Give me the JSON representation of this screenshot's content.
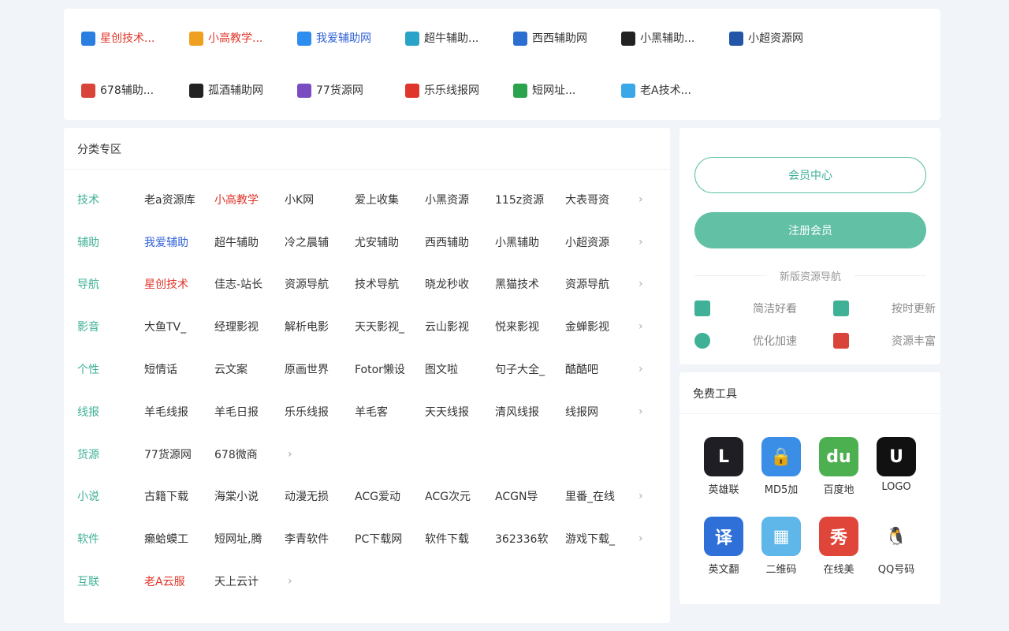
{
  "top_links": [
    {
      "label": "星创技术...",
      "color": "#e0352b",
      "icon": "star-logo-icon",
      "icon_bg": "#2a7de1"
    },
    {
      "label": "小高教学...",
      "color": "#e0352b",
      "icon": "gold-badge-icon",
      "icon_bg": "#f0a020"
    },
    {
      "label": "我爱辅助网",
      "color": "#2e5fd6",
      "icon": "edit-square-icon",
      "icon_bg": "#2e8ef0"
    },
    {
      "label": "超牛辅助...",
      "color": "#333333",
      "icon": "dj-logo-icon",
      "icon_bg": "#2aa3c8"
    },
    {
      "label": "西西辅助网",
      "color": "#333333",
      "icon": "x-logo-icon",
      "icon_bg": "#2c6fd0"
    },
    {
      "label": "小黑辅助...",
      "color": "#333333",
      "icon": "person-silhouette-icon",
      "icon_bg": "#222222"
    },
    {
      "label": "小超资源网",
      "color": "#333333",
      "icon": "flame-logo-icon",
      "icon_bg": "#2456a8"
    },
    {
      "label": "678辅助...",
      "color": "#333333",
      "icon": "678-logo-icon",
      "icon_bg": "#d8443a"
    },
    {
      "label": "孤酒辅助网",
      "color": "#333333",
      "icon": "qq-penguin-icon",
      "icon_bg": "#222222"
    },
    {
      "label": "77货源网",
      "color": "#333333",
      "icon": "seven-logo-icon",
      "icon_bg": "#7a4cc2"
    },
    {
      "label": "乐乐线报网",
      "color": "#333333",
      "icon": "s-logo-icon",
      "icon_bg": "#e0352b"
    },
    {
      "label": "短网址...",
      "color": "#333333",
      "icon": "g-logo-icon",
      "icon_bg": "#2ba24c"
    },
    {
      "label": "老A技术...",
      "color": "#333333",
      "icon": "water-drop-icon",
      "icon_bg": "#39a7e8"
    }
  ],
  "category": {
    "title": "分类专区",
    "rows": [
      {
        "name": "技术",
        "items": [
          {
            "label": "老a资源库",
            "color": "#333333"
          },
          {
            "label": "小高教学",
            "color": "#e0352b"
          },
          {
            "label": "小K网",
            "color": "#333333"
          },
          {
            "label": "爱上收集",
            "color": "#333333"
          },
          {
            "label": "小黑资源",
            "color": "#333333"
          },
          {
            "label": "115z资源",
            "color": "#333333"
          },
          {
            "label": "大表哥资",
            "color": "#333333"
          }
        ]
      },
      {
        "name": "辅助",
        "items": [
          {
            "label": "我爱辅助",
            "color": "#2e5fd6"
          },
          {
            "label": "超牛辅助",
            "color": "#333333"
          },
          {
            "label": "冷之晨辅",
            "color": "#333333"
          },
          {
            "label": "尤安辅助",
            "color": "#333333"
          },
          {
            "label": "西西辅助",
            "color": "#333333"
          },
          {
            "label": "小黑辅助",
            "color": "#333333"
          },
          {
            "label": "小超资源",
            "color": "#333333"
          }
        ]
      },
      {
        "name": "导航",
        "items": [
          {
            "label": "星创技术",
            "color": "#e0352b"
          },
          {
            "label": "佳志-站长",
            "color": "#333333"
          },
          {
            "label": "资源导航",
            "color": "#333333"
          },
          {
            "label": "技术导航",
            "color": "#333333"
          },
          {
            "label": "晓龙秒收",
            "color": "#333333"
          },
          {
            "label": "黑猫技术",
            "color": "#333333"
          },
          {
            "label": "资源导航",
            "color": "#333333"
          }
        ]
      },
      {
        "name": "影音",
        "items": [
          {
            "label": "大鱼TV_",
            "color": "#333333"
          },
          {
            "label": "经理影视",
            "color": "#333333"
          },
          {
            "label": "解析电影",
            "color": "#333333"
          },
          {
            "label": "天天影视_",
            "color": "#333333"
          },
          {
            "label": "云山影视",
            "color": "#333333"
          },
          {
            "label": "悦来影视",
            "color": "#333333"
          },
          {
            "label": "金蝉影视",
            "color": "#333333"
          }
        ]
      },
      {
        "name": "个性",
        "items": [
          {
            "label": "短情话",
            "color": "#333333"
          },
          {
            "label": "云文案",
            "color": "#333333"
          },
          {
            "label": "原画世界",
            "color": "#333333"
          },
          {
            "label": "Fotor懒设",
            "color": "#333333"
          },
          {
            "label": "图文啦",
            "color": "#333333"
          },
          {
            "label": "句子大全_",
            "color": "#333333"
          },
          {
            "label": "酷酷吧",
            "color": "#333333"
          }
        ]
      },
      {
        "name": "线报",
        "items": [
          {
            "label": "羊毛线报",
            "color": "#333333"
          },
          {
            "label": "羊毛日报",
            "color": "#333333"
          },
          {
            "label": "乐乐线报",
            "color": "#333333"
          },
          {
            "label": "羊毛客",
            "color": "#333333"
          },
          {
            "label": "天天线报",
            "color": "#333333"
          },
          {
            "label": "清风线报",
            "color": "#333333"
          },
          {
            "label": "线报网",
            "color": "#333333"
          }
        ]
      },
      {
        "name": "货源",
        "items": [
          {
            "label": "77货源网",
            "color": "#333333"
          },
          {
            "label": "678微商",
            "color": "#333333"
          }
        ]
      },
      {
        "name": "小说",
        "items": [
          {
            "label": "古籍下载",
            "color": "#333333"
          },
          {
            "label": "海棠小说",
            "color": "#333333"
          },
          {
            "label": "动漫无损",
            "color": "#333333"
          },
          {
            "label": "ACG爱动",
            "color": "#333333"
          },
          {
            "label": "ACG次元",
            "color": "#333333"
          },
          {
            "label": "ACGN导",
            "color": "#333333"
          },
          {
            "label": "里番_在线",
            "color": "#333333"
          }
        ]
      },
      {
        "name": "软件",
        "items": [
          {
            "label": "癞蛤蟆工",
            "color": "#333333"
          },
          {
            "label": "短网址,腾",
            "color": "#333333"
          },
          {
            "label": "李青软件",
            "color": "#333333"
          },
          {
            "label": "PC下载网",
            "color": "#333333"
          },
          {
            "label": "软件下载",
            "color": "#333333"
          },
          {
            "label": "362336软",
            "color": "#333333"
          },
          {
            "label": "游戏下载_",
            "color": "#333333"
          }
        ]
      },
      {
        "name": "互联",
        "items": [
          {
            "label": "老A云服",
            "color": "#e0352b"
          },
          {
            "label": "天上云计",
            "color": "#333333"
          }
        ]
      }
    ],
    "arrow": "›"
  },
  "member": {
    "center_label": "会员中心",
    "register_label": "注册会员",
    "divider_label": "新版资源导航",
    "features": [
      {
        "label": "简洁好看",
        "icon": "envelope-icon",
        "color": "#3eb197"
      },
      {
        "label": "按时更新",
        "icon": "document-icon",
        "color": "#3eb197"
      },
      {
        "label": "优化加速",
        "icon": "vip-refresh-icon",
        "color": "#3eb197"
      },
      {
        "label": "资源丰富",
        "icon": "laptop-icon",
        "color": "#d8443a"
      }
    ]
  },
  "tools": {
    "title": "免费工具",
    "items": [
      {
        "label": "英雄联",
        "icon": "lol-icon",
        "glyph": "L",
        "bg": "#1e1e24"
      },
      {
        "label": "MD5加",
        "icon": "lock-icon",
        "glyph": "🔒",
        "bg": "#3a8ee6"
      },
      {
        "label": "百度地",
        "icon": "map-pin-icon",
        "glyph": "du",
        "bg": "#4caf50"
      },
      {
        "label": "LOGO",
        "icon": "gear-logo-icon",
        "glyph": "U",
        "bg": "#111111"
      },
      {
        "label": "英文翻",
        "icon": "translate-icon",
        "glyph": "译",
        "bg": "#2e6fd8"
      },
      {
        "label": "二维码",
        "icon": "qr-code-icon",
        "glyph": "▦",
        "bg": "#5fb6e8"
      },
      {
        "label": "在线美",
        "icon": "beauty-icon",
        "glyph": "秀",
        "bg": "#e0453a"
      },
      {
        "label": "QQ号码",
        "icon": "qq-penguin-icon",
        "glyph": "🐧",
        "bg": "#ffffff"
      }
    ]
  }
}
